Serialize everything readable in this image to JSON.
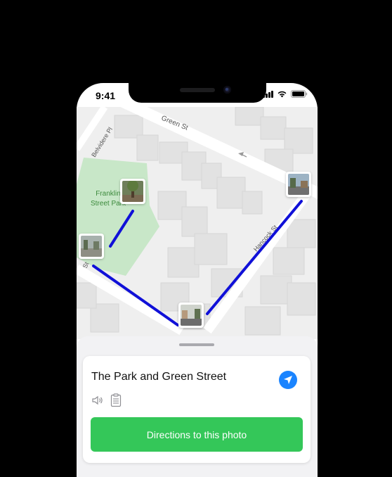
{
  "status_bar": {
    "time": "9:41"
  },
  "map": {
    "street_labels": [
      "Green St",
      "Belvidere Pl",
      "Hancock St",
      "St"
    ],
    "park_label_lines": [
      "Franklin",
      "Street Park"
    ],
    "route_color": "#1010d8",
    "park_color": "#c8e7c8",
    "photo_markers": [
      {
        "name": "photo-marker-park",
        "icon": "photo-thumbnail"
      },
      {
        "name": "photo-marker-west",
        "icon": "photo-thumbnail"
      },
      {
        "name": "photo-marker-south",
        "icon": "photo-thumbnail"
      },
      {
        "name": "photo-marker-east",
        "icon": "photo-thumbnail"
      }
    ]
  },
  "card": {
    "title": "The Park and Green Street",
    "navigate_icon": "navigation-arrow-icon",
    "audio_icon": "speaker-icon",
    "notes_icon": "clipboard-icon",
    "directions_button": "Directions to this photo",
    "accent_color": "#1a84ff",
    "button_color": "#34c759"
  }
}
